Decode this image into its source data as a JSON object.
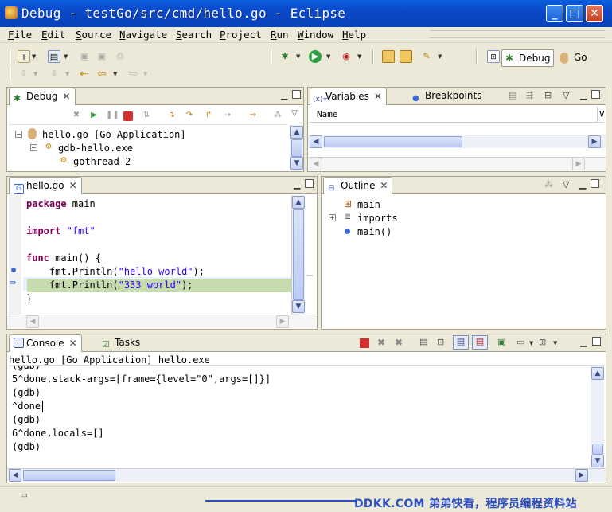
{
  "window": {
    "title": "Debug - testGo/src/cmd/hello.go - Eclipse"
  },
  "menu": [
    "File",
    "Edit",
    "Source",
    "Navigate",
    "Search",
    "Project",
    "Run",
    "Window",
    "Help"
  ],
  "perspectives": {
    "debug": "Debug",
    "go": "Go"
  },
  "debug_view": {
    "tab": "Debug",
    "tree": [
      "hello.go [Go Application]",
      "gdb-hello.exe",
      "gothread-2"
    ]
  },
  "variables_view": {
    "tab_variables": "Variables",
    "tab_breakpoints": "Breakpoints",
    "column_name": "Name",
    "column_value": "V"
  },
  "editor": {
    "tab": "hello.go",
    "lines": [
      {
        "kw": "package",
        "rest": " main"
      },
      {
        "kw": "",
        "rest": ""
      },
      {
        "kw": "import",
        "rest": " ",
        "str": "\"fmt\""
      },
      {
        "kw": "",
        "rest": ""
      },
      {
        "kw": "func",
        "rest": " main() {"
      },
      {
        "pre": "    fmt.Println(",
        "str": "\"hello world\"",
        "post": ");"
      },
      {
        "pre": "    fmt.Println(",
        "str": "\"333 world\"",
        "post": ");"
      },
      {
        "pre": "}"
      }
    ]
  },
  "outline_view": {
    "tab": "Outline",
    "items": [
      "main",
      "imports",
      "main()"
    ]
  },
  "console_view": {
    "tab_console": "Console",
    "tab_tasks": "Tasks",
    "header": "hello.go [Go Application] hello.exe",
    "lines": [
      "(gdb)",
      "5^done,stack-args=[frame={level=\"0\",args=[]}]",
      "(gdb)",
      "^done",
      "(gdb)",
      "6^done,locals=[]",
      "(gdb)"
    ]
  },
  "watermark": "DDKK.COM 弟弟快看，程序员编程资料站",
  "colors": {
    "titlebar": "#0a48c8",
    "keyword": "#7f0055",
    "string": "#2a00ff",
    "current_line": "#c6dbae"
  }
}
